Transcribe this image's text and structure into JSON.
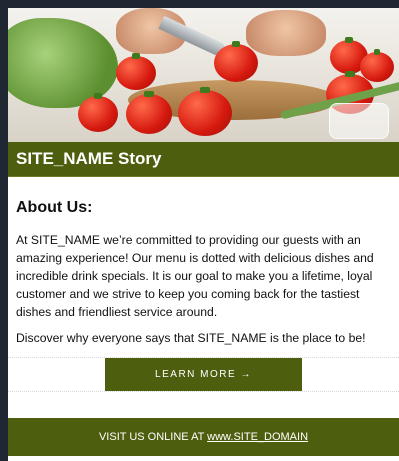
{
  "header": {
    "title": "SITE_NAME Story"
  },
  "main": {
    "heading": "About Us:",
    "paragraph_1": "At SITE_NAME we’re committed to providing our guests with an amazing experience! Our menu is dotted with delicious dishes and incredible drink specials. It is our goal to make you a lifetime, loyal customer and we strive to keep you coming back for the tastiest dishes and friendliest service around.",
    "paragraph_2": "Discover why everyone says that SITE_NAME is the place to be!",
    "cta_label": "LEARN MORE →"
  },
  "footer": {
    "prefix": "VISIT US ONLINE AT ",
    "link": "www.SITE_DOMAIN"
  },
  "colors": {
    "brand_green": "#4d5f0f",
    "page_background": "#1f2733"
  }
}
